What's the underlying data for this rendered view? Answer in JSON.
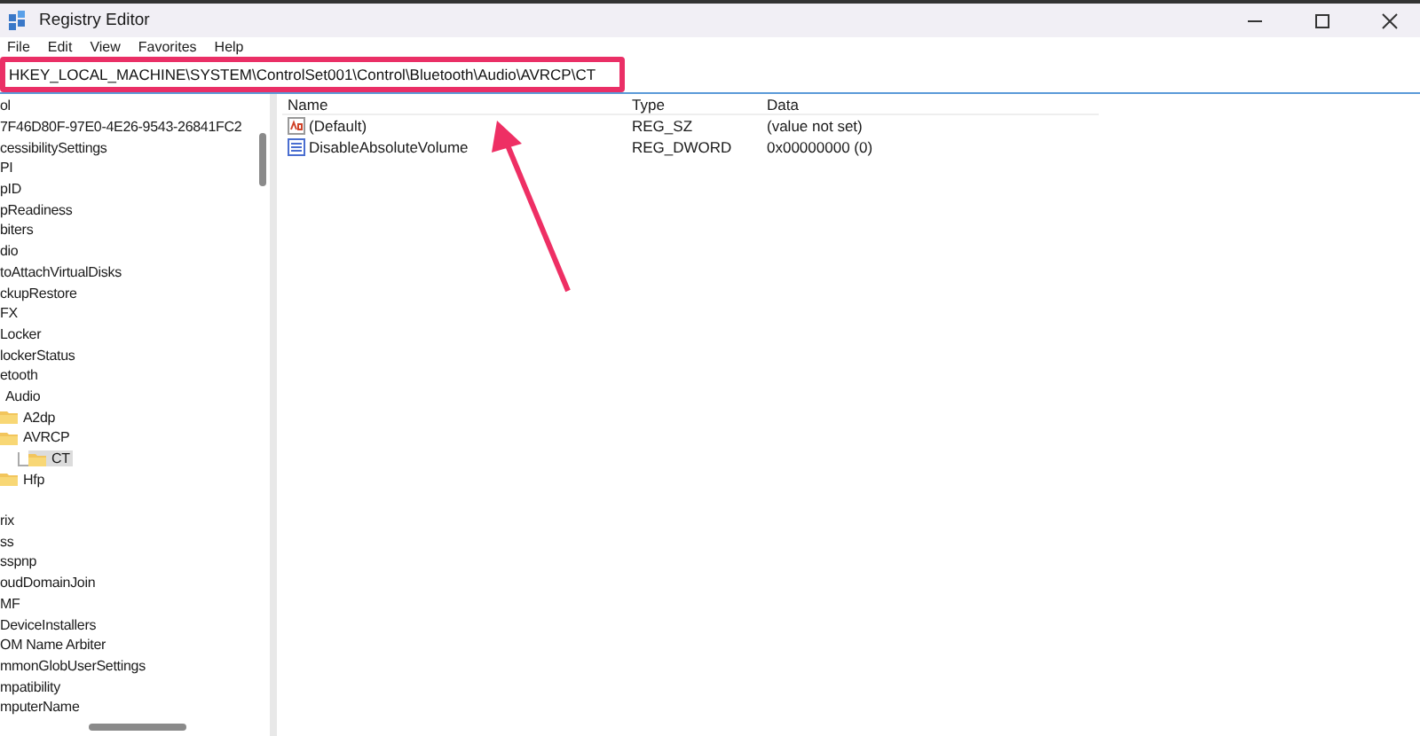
{
  "window": {
    "title": "Registry Editor"
  },
  "menu": [
    "File",
    "Edit",
    "View",
    "Favorites",
    "Help"
  ],
  "address": {
    "value": "HKEY_LOCAL_MACHINE\\SYSTEM\\ControlSet001\\Control\\Bluetooth\\Audio\\AVRCP\\CT"
  },
  "tree": [
    {
      "label": "ol",
      "selected": false
    },
    {
      "label": "7F46D80F-97E0-4E26-9543-26841FC2",
      "selected": false
    },
    {
      "label": "cessibilitySettings",
      "selected": false
    },
    {
      "label": "PI",
      "selected": false
    },
    {
      "label": "pID",
      "selected": false
    },
    {
      "label": "pReadiness",
      "selected": false
    },
    {
      "label": "biters",
      "selected": false
    },
    {
      "label": "dio",
      "selected": false
    },
    {
      "label": "toAttachVirtualDisks",
      "selected": false
    },
    {
      "label": "ckupRestore",
      "selected": false
    },
    {
      "label": "FX",
      "selected": false
    },
    {
      "label": "Locker",
      "selected": false
    },
    {
      "label": "lockerStatus",
      "selected": false
    },
    {
      "label": "etooth",
      "selected": false,
      "children": [
        {
          "label": "Audio",
          "selected": false,
          "children": [
            {
              "label": "A2dp",
              "selected": false
            },
            {
              "label": "AVRCP",
              "selected": false,
              "children": [
                {
                  "label": "CT",
                  "selected": true
                }
              ]
            },
            {
              "label": "Hfp",
              "selected": false
            }
          ]
        }
      ]
    },
    {
      "label": "rix",
      "selected": false
    },
    {
      "label": "ss",
      "selected": false
    },
    {
      "label": "sspnp",
      "selected": false
    },
    {
      "label": "oudDomainJoin",
      "selected": false
    },
    {
      "label": "MF",
      "selected": false
    },
    {
      "label": "DeviceInstallers",
      "selected": false
    },
    {
      "label": "OM Name Arbiter",
      "selected": false
    },
    {
      "label": "mmonGlobUserSettings",
      "selected": false
    },
    {
      "label": "mpatibility",
      "selected": false
    },
    {
      "label": "mputerName",
      "selected": false
    }
  ],
  "columns": [
    "Name",
    "Type",
    "Data"
  ],
  "values": [
    {
      "kind": "string",
      "name": "(Default)",
      "type": "REG_SZ",
      "data": "(value not set)",
      "selected": false
    },
    {
      "kind": "binary",
      "name": "DisableAbsoluteVolume",
      "type": "REG_DWORD",
      "data": "0x00000000 (0)",
      "selected": false
    }
  ]
}
